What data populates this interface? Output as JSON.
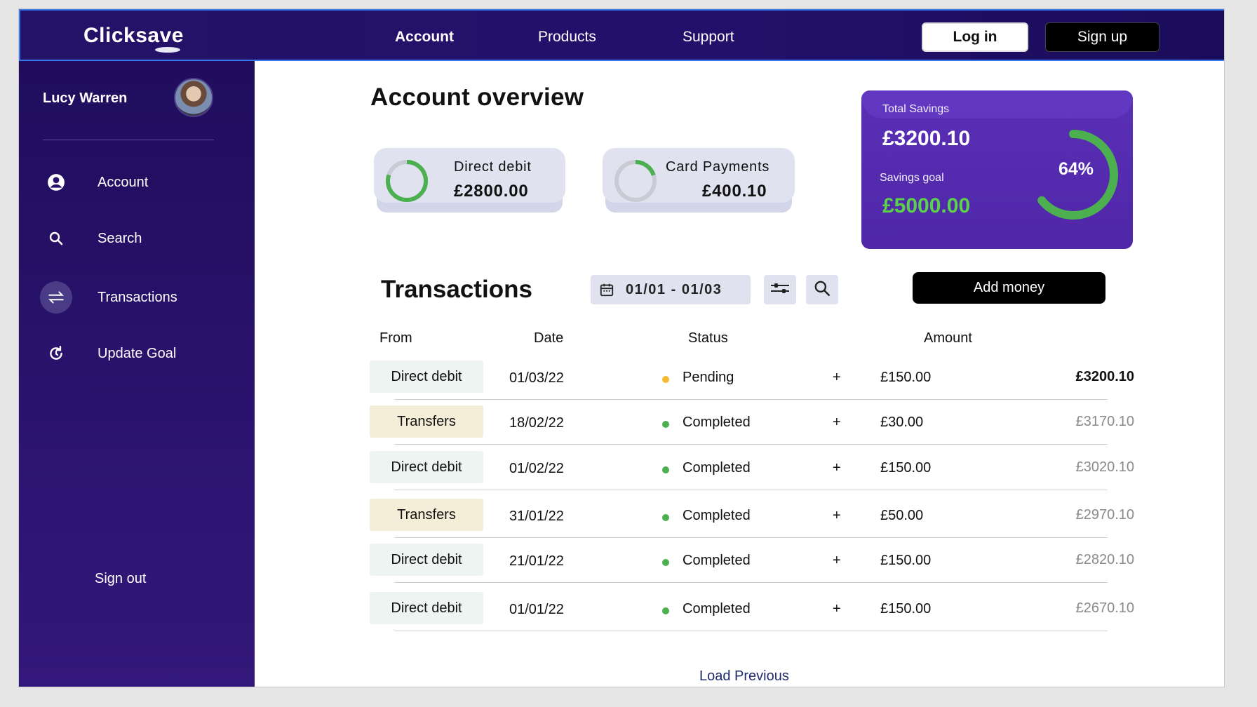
{
  "brand": {
    "name": "Clicksave"
  },
  "nav": {
    "items": [
      {
        "label": "Account"
      },
      {
        "label": "Products"
      },
      {
        "label": "Support"
      }
    ],
    "login_label": "Log in",
    "signup_label": "Sign up"
  },
  "sidebar": {
    "user_name": "Lucy Warren",
    "items": [
      {
        "label": "Account",
        "icon": "user-icon"
      },
      {
        "label": "Search",
        "icon": "search-icon"
      },
      {
        "label": "Transactions",
        "icon": "transfer-arrows-icon",
        "active": true
      },
      {
        "label": "Update Goal",
        "icon": "refresh-icon"
      }
    ],
    "signout_label": "Sign out"
  },
  "main": {
    "title": "Account overview",
    "cards": [
      {
        "label": "Direct debit",
        "value": "£2800.00",
        "ring_color": "#4caf50",
        "ring_fraction": 0.8
      },
      {
        "label": "Card Payments",
        "value": "£400.10",
        "ring_color": "#4caf50",
        "ring_fraction": 0.2
      }
    ],
    "savings": {
      "title": "Total Savings",
      "total": "£3200.10",
      "goal_label": "Savings goal",
      "goal": "£5000.00",
      "percent_label": "64%",
      "percent": 64,
      "accent": "#5bd04a"
    }
  },
  "transactions": {
    "title": "Transactions",
    "date_range": "01/01 - 01/03",
    "add_money_label": "Add money",
    "columns": {
      "from": "From",
      "date": "Date",
      "status": "Status",
      "amount": "Amount"
    },
    "rows": [
      {
        "from": "Direct debit",
        "date": "01/03/22",
        "status": "Pending",
        "status_color": "#f5b82e",
        "sign": "+",
        "amount": "£150.00",
        "balance": "£3200.10"
      },
      {
        "from": "Transfers",
        "date": "18/02/22",
        "status": "Completed",
        "status_color": "#4caf50",
        "sign": "+",
        "amount": "£30.00",
        "balance": "£3170.10"
      },
      {
        "from": "Direct debit",
        "date": "01/02/22",
        "status": "Completed",
        "status_color": "#4caf50",
        "sign": "+",
        "amount": "£150.00",
        "balance": "£3020.10"
      },
      {
        "from": "Transfers",
        "date": "31/01/22",
        "status": "Completed",
        "status_color": "#4caf50",
        "sign": "+",
        "amount": "£50.00",
        "balance": "£2970.10"
      },
      {
        "from": "Direct debit",
        "date": "21/01/22",
        "status": "Completed",
        "status_color": "#4caf50",
        "sign": "+",
        "amount": "£150.00",
        "balance": "£2820.10"
      },
      {
        "from": "Direct debit",
        "date": "01/01/22",
        "status": "Completed",
        "status_color": "#4caf50",
        "sign": "+",
        "amount": "£150.00",
        "balance": "£2670.10"
      }
    ],
    "load_previous_label": "Load Previous"
  }
}
